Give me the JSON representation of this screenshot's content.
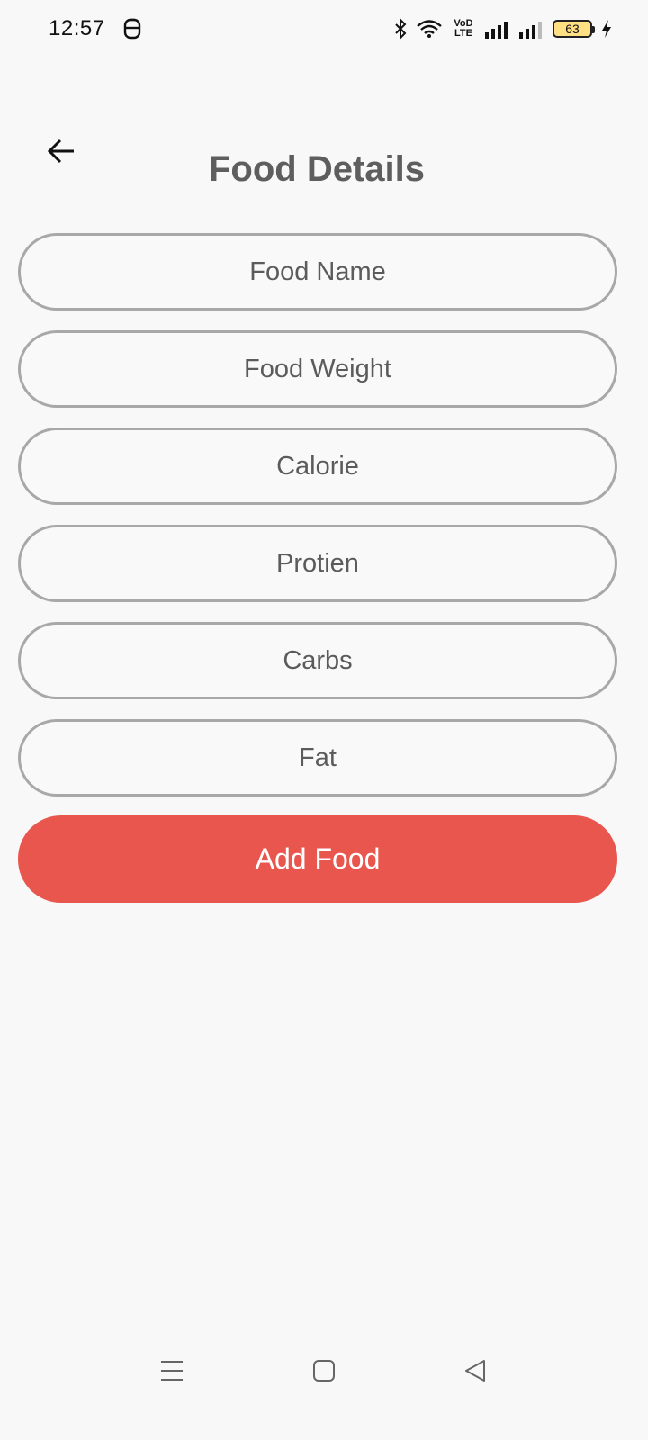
{
  "status_bar": {
    "time": "12:57",
    "lte_top": "VoD",
    "lte_bottom": "LTE",
    "battery": "63",
    "icons": [
      "notification-icon",
      "bluetooth-icon",
      "wifi-icon",
      "volte-icon",
      "signal-icon",
      "signal-icon",
      "battery-icon",
      "charging-icon"
    ]
  },
  "header": {
    "back_icon": "arrow-left-icon",
    "title": "Food Details"
  },
  "form": {
    "fields": [
      {
        "placeholder": "Food Name",
        "value": ""
      },
      {
        "placeholder": "Food Weight",
        "value": ""
      },
      {
        "placeholder": "Calorie",
        "value": ""
      },
      {
        "placeholder": "Protien",
        "value": ""
      },
      {
        "placeholder": "Carbs",
        "value": ""
      },
      {
        "placeholder": "Fat",
        "value": ""
      }
    ],
    "submit_label": "Add Food"
  },
  "nav_bar": {
    "icons": [
      "menu-icon",
      "home-icon",
      "back-triangle-icon"
    ]
  },
  "colors": {
    "background": "#f8f8f8",
    "accent": "#e9564d",
    "field_border": "#a8a8a8",
    "text": "#5b5b5b"
  }
}
